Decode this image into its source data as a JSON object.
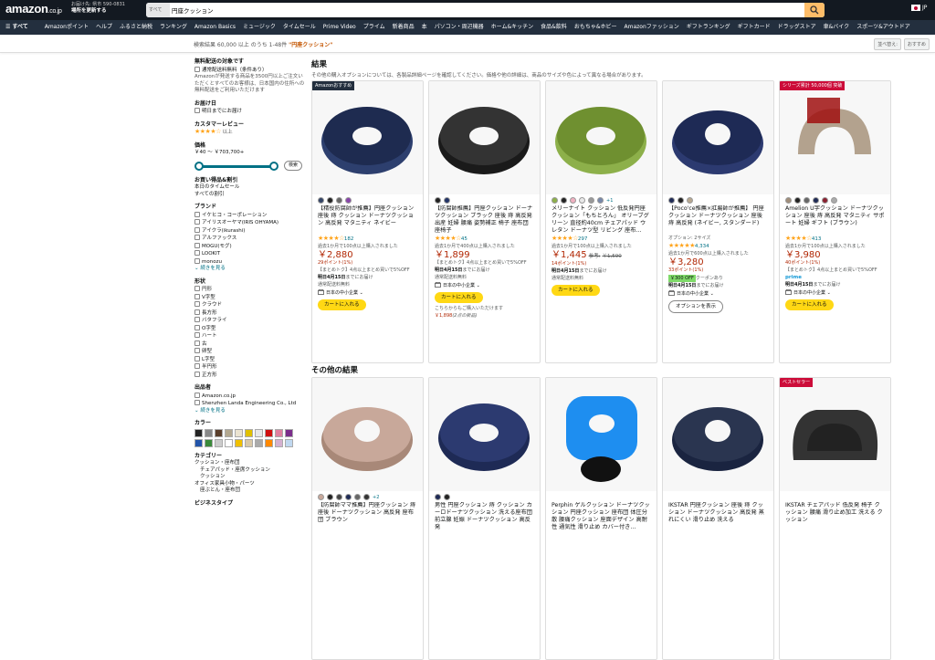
{
  "header": {
    "logo": "amazon",
    "logo_suffix": ".co.jp",
    "deliver_line1": "お届け先: 県市 590-0831",
    "deliver_line2": "場所を更新する",
    "search_category": "すべて",
    "search_value": "円座クッション",
    "lang": "JP"
  },
  "nav": {
    "all": "すべて",
    "items": [
      "Amazonポイント",
      "ヘルプ",
      "ふるさと納税",
      "ランキング",
      "Amazon Basics",
      "ミュージック",
      "タイムセール",
      "Prime Video",
      "プライム",
      "新着商品",
      "本",
      "パソコン・周辺機器",
      "ホーム&キッチン",
      "食品&飲料",
      "おもちゃ&ホビー",
      "Amazonファッション",
      "ギフトランキング",
      "ギフトカード",
      "ドラッグストア",
      "車&バイク",
      "スポーツ&アウトドア"
    ]
  },
  "results": {
    "prefix": "検索結果 60,000 以上 のうち 1-48件 ",
    "query": "\"円座クッション\"",
    "sort_label": "並べ替え:",
    "sort_value": "おすすめ"
  },
  "sidebar": {
    "free_ship_h": "無料配送の対象です",
    "free_ship_cb": "通常配送料無料（条件あり）",
    "free_ship_note": "Amazonが発送する商品を3500円以上ご注文いただくとすべてのお客様は、日本国内の住所への無料配送をご利用いただけます",
    "delivery_h": "お届け日",
    "delivery_cb": "明日までにお届け",
    "review_h": "カスタマーレビュー",
    "review_stars": "★★★★☆",
    "review_suffix": "以上",
    "price_h": "価格",
    "price_range": "￥40 〜 ￥703,700+",
    "price_go": "検索",
    "deals_h": "お買い得品&割引",
    "deals": [
      "本日のタイムセール",
      "すべての割引"
    ],
    "brand_h": "ブランド",
    "brands": [
      "イケヒコ・コーポレーション",
      "アイリスオーヤマ(IRIS OHYAMA)",
      "アイクラ(ikurashi)",
      "アルファックス",
      "MOGU(モグ)",
      "LOOKIT",
      "monozu"
    ],
    "see_more": "続きを見る",
    "shape_h": "形状",
    "shapes": [
      "円形",
      "V字型",
      "クラウド",
      "長方形",
      "バタフライ",
      "O字型",
      "ハート",
      "古",
      "卵型",
      "L字型",
      "半円形",
      "正方形"
    ],
    "seller_h": "出品者",
    "sellers": [
      "Amazon.co.jp",
      "Shenzhen Landa Engineering Co., Ltd"
    ],
    "color_h": "カラー",
    "colors": [
      "#222222",
      "#888888",
      "#5a3e2b",
      "#b3a890",
      "#ebe3d0",
      "#e0c000",
      "#e8e8e8",
      "#d01010",
      "#e080a0",
      "#7b2d8b",
      "#2255aa",
      "#3a8a3a",
      "#cccccc",
      "#ffffff",
      "#f0c000",
      "#d8c8a8",
      "#aaaaaa",
      "#ff8800",
      "#d4b0d0",
      "#c0d8f0"
    ],
    "cat_h": "カテゴリー",
    "cats": [
      "クッション・座布団",
      "チェアパッド・座席クッション",
      "クッション",
      "オフィス家具小物・パーツ",
      "座ぶとん・座布団"
    ],
    "biz_h": "ビジネスタイプ"
  },
  "sections": {
    "results_h": "結果",
    "results_sub": "その他の購入オプションについては、各製品詳細ページを確認してください。価格や他の詳細は、商品のサイズや色によって異なる場合があります。",
    "others_h": "その他の結果"
  },
  "products": [
    {
      "badge": "Amazonおすすめ",
      "dots": [
        "#334466",
        "#222222",
        "#666666",
        "#8844aa"
      ],
      "title": "【精役防腐師が推薦】円座クッション 座後 痔 クッション ドーナツクッション 高反発 マタニティ ネイビー",
      "stars": "★★★★☆",
      "reviews": "182",
      "past": "過去1か月で100点以上購入されました",
      "price": "￥2,880",
      "points": "29ポイント(1%)",
      "note": "【まとめトク】4点以上まとめ買いで5%OFF",
      "ship_date": "明日4月15日",
      "ship_suffix": "までにお届け",
      "ship_free": "通常配送料無料",
      "seller": "日本の中小企業",
      "cart": "カートに入れる"
    },
    {
      "badge": "",
      "dots": [
        "#222222",
        "#223366"
      ],
      "title": "【防腐師推薦】円座クッション ドーナツクッション ブラック 座後 痔 高反発 出産 妊婦 腰痛 姿勢補正 椅子 座布団 座椅子",
      "stars": "★★★★☆",
      "reviews": "45",
      "past": "過去1か月で400点以上購入されました",
      "price": "￥1,899",
      "points": "",
      "note": "【まとめトク】4点以上まとめ買いで5%OFF",
      "ship_date": "明日4月15日",
      "ship_suffix": "までにお届け",
      "ship_free": "通常配送料無料",
      "seller": "日本の中小企業",
      "cart": "カートに入れる",
      "alt_text": "こちらからもご購入いただけます",
      "alt_price": "￥1,898",
      "alt_suffix": "(2点の新品)"
    },
    {
      "badge": "",
      "dots": [
        "#8db04a",
        "#222222",
        "#f0b0c0",
        "#e8e8e8",
        "#999999",
        "#7788aa"
      ],
      "more": "+1",
      "title": "メリーナイト クッション 低反発円座クッション「もちとろん」 オリーブグリーン 直径約40cm チェアパッド ウレタン ドーナツ型 リビング 座布…",
      "stars": "★★★★☆",
      "reviews": "297",
      "past": "過去1か月で100点以上購入されました",
      "price": "￥1,445",
      "list": "￥1,590",
      "list_prefix": "参考:",
      "points": "14ポイント(1%)",
      "ship_date": "明日4月15日",
      "ship_suffix": "までにお届け",
      "ship_free": "通常配送料無料",
      "cart": "カートに入れる"
    },
    {
      "badge": "",
      "dots": [
        "#1e2a55",
        "#222222",
        "#b8a890"
      ],
      "title": "【Poco'ce推薦×肛腸師が推薦】 円座クッション ドーナツクッション 座後 痔 高反発 (ネイビー, スタンダード)",
      "option": "オプション: 2サイズ",
      "stars": "★★★★★",
      "reviews": "4,334",
      "past": "過去1か月で600点以上購入されました",
      "price": "￥3,280",
      "points": "33ポイント(1%)",
      "coupon": "￥300 OFF",
      "coupon_suffix": "クーポンあり",
      "ship_date": "明日4月15日",
      "ship_suffix": "までにお届け",
      "seller": "日本の中小企業",
      "cart": "オプションを表示"
    },
    {
      "badge": "シリーズ累計 50,000個 突破",
      "dots": [
        "#a08e7a",
        "#222222",
        "#666666",
        "#1e2a55",
        "#8a2030",
        "#aaaaaa"
      ],
      "title": "Amelion U字クッション ドーナツクッション 座後 痔 高反発 マタニティ サポート 妊婦 ギフト (ブラウン)",
      "stars": "★★★★☆",
      "reviews": "413",
      "past": "過去1か月で100点以上購入されました",
      "price": "￥3,980",
      "points": "40ポイント(1%)",
      "note": "【まとめトク】4点以上まとめ買いで5%OFF",
      "prime": "prime",
      "ship_date": "明日4月15日",
      "ship_suffix": "までにお届け",
      "seller": "日本の中小企業",
      "cart": "カートに入れる"
    }
  ],
  "products2": [
    {
      "badge": "",
      "dots": [
        "#c8a89a",
        "#222222",
        "#444444",
        "#1e2a55",
        "#666666",
        "#333333"
      ],
      "more": "+2",
      "title": "【防腐師ママ推薦】円座クッション 痔 座後 ドーナツクッション 高反発 座布団 ブラウン"
    },
    {
      "badge": "",
      "dots": [
        "#1e2a55",
        "#222222"
      ],
      "title": "男性 円座クッション 痔 クッション カーロドーナツクッション 洗える座布団 前立腺 妊娠 ドーナツクッション 高反発"
    },
    {
      "badge": "",
      "dots": [],
      "title": "Perphin ゲルクッション ドーナツクッション 円座クッション 座布団 体圧分散 腰痛クッション 座面デザイン 高耐性 通気性 滑り止め カバー付き…"
    },
    {
      "badge": "",
      "dots": [],
      "title": "IKSTAR 円座クッション 座後 痔 クッション ドーナツクッション 高反発 蒸れにくい 滑り止め 洗える"
    },
    {
      "badge": "ベストセラー",
      "dots": [],
      "title": "IKSTAR チェアパッド 低反発 椅子 クッション 腰痛 滑り止め加工 洗える クッション"
    }
  ]
}
